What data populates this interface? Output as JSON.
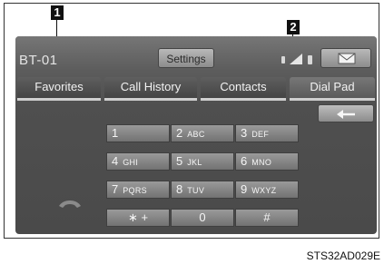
{
  "callouts": [
    "1",
    "2"
  ],
  "status_bar": {
    "device_name": "BT-01",
    "settings_label": "Settings",
    "icons": [
      "bluetooth-icon",
      "signal-strength-icon",
      "battery-icon"
    ],
    "mail_icon": "mail-icon"
  },
  "tabs": [
    {
      "label": "Favorites"
    },
    {
      "label": "Call History"
    },
    {
      "label": "Contacts"
    },
    {
      "label": "Dial Pad"
    }
  ],
  "back_icon": "backspace-arrow-icon",
  "keypad": [
    {
      "num": "1",
      "letters": ""
    },
    {
      "num": "2",
      "letters": "ABC"
    },
    {
      "num": "3",
      "letters": "DEF"
    },
    {
      "num": "4",
      "letters": "GHI"
    },
    {
      "num": "5",
      "letters": "JKL"
    },
    {
      "num": "6",
      "letters": "MNO"
    },
    {
      "num": "7",
      "letters": "PQRS"
    },
    {
      "num": "8",
      "letters": "TUV"
    },
    {
      "num": "9",
      "letters": "WXYZ"
    },
    {
      "num": "∗ +",
      "letters": ""
    },
    {
      "num": "0",
      "letters": ""
    },
    {
      "num": "#",
      "letters": ""
    }
  ],
  "call_icon": "phone-handset-icon",
  "caption": "STS32AD029E"
}
